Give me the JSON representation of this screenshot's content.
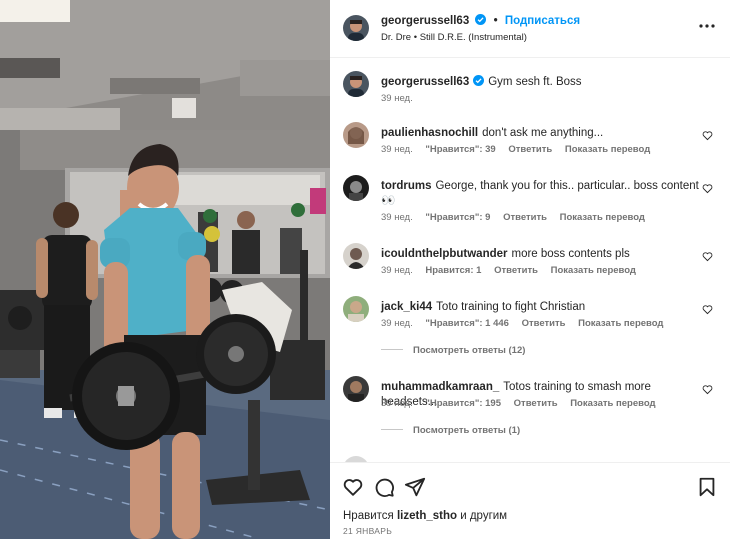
{
  "header": {
    "username": "georgerussell63",
    "separator": "•",
    "follow_label": "Подписаться",
    "music": "Dr. Dre • Still D.R.E. (Instrumental)"
  },
  "caption": {
    "username": "georgerussell63",
    "text": "Gym sesh ft. Boss",
    "time": "39 нед."
  },
  "comments": [
    {
      "username": "paulienhasnochill",
      "text": "don't ask me anything...",
      "time": "39 нед.",
      "likes": "\"Нравится\": 39",
      "reply": "Ответить",
      "translate": "Показать перевод"
    },
    {
      "username": "tordrums",
      "text": "George, thank you for this.. particular.. boss content 👀",
      "time": "39 нед.",
      "likes": "\"Нравится\": 9",
      "reply": "Ответить",
      "translate": "Показать перевод"
    },
    {
      "username": "icouldnthelpbutwander",
      "text": "more boss contents pls",
      "time": "39 нед.",
      "likes": "Нравится: 1",
      "reply": "Ответить",
      "translate": "Показать перевод"
    },
    {
      "username": "jack_ki44",
      "text": "Toto training to fight Christian",
      "time": "39 нед.",
      "likes": "\"Нравится\": 1 446",
      "reply": "Ответить",
      "translate": "Показать перевод",
      "replies": "Посмотреть ответы (12)"
    },
    {
      "username": "muhammadkamraan_",
      "text": "Totos training to smash more headsets...",
      "time": "39 нед.",
      "likes": "\"Нравится\": 195",
      "reply": "Ответить",
      "translate": "Показать перевод",
      "replies": "Посмотреть ответы (1)"
    }
  ],
  "footer": {
    "likes_prefix": "Нравится",
    "likes_user": "lizeth_stho",
    "likes_suffix": "и другим",
    "date": "21 ЯНВАРЬ"
  },
  "icons": {
    "more": "more-horizontal-icon",
    "heart": "heart-icon",
    "comment": "comment-icon",
    "share": "share-icon",
    "save": "bookmark-icon",
    "verified": "verified-badge-icon"
  },
  "colors": {
    "accent": "#0095f6",
    "text": "#262626",
    "secondary": "#737373"
  }
}
